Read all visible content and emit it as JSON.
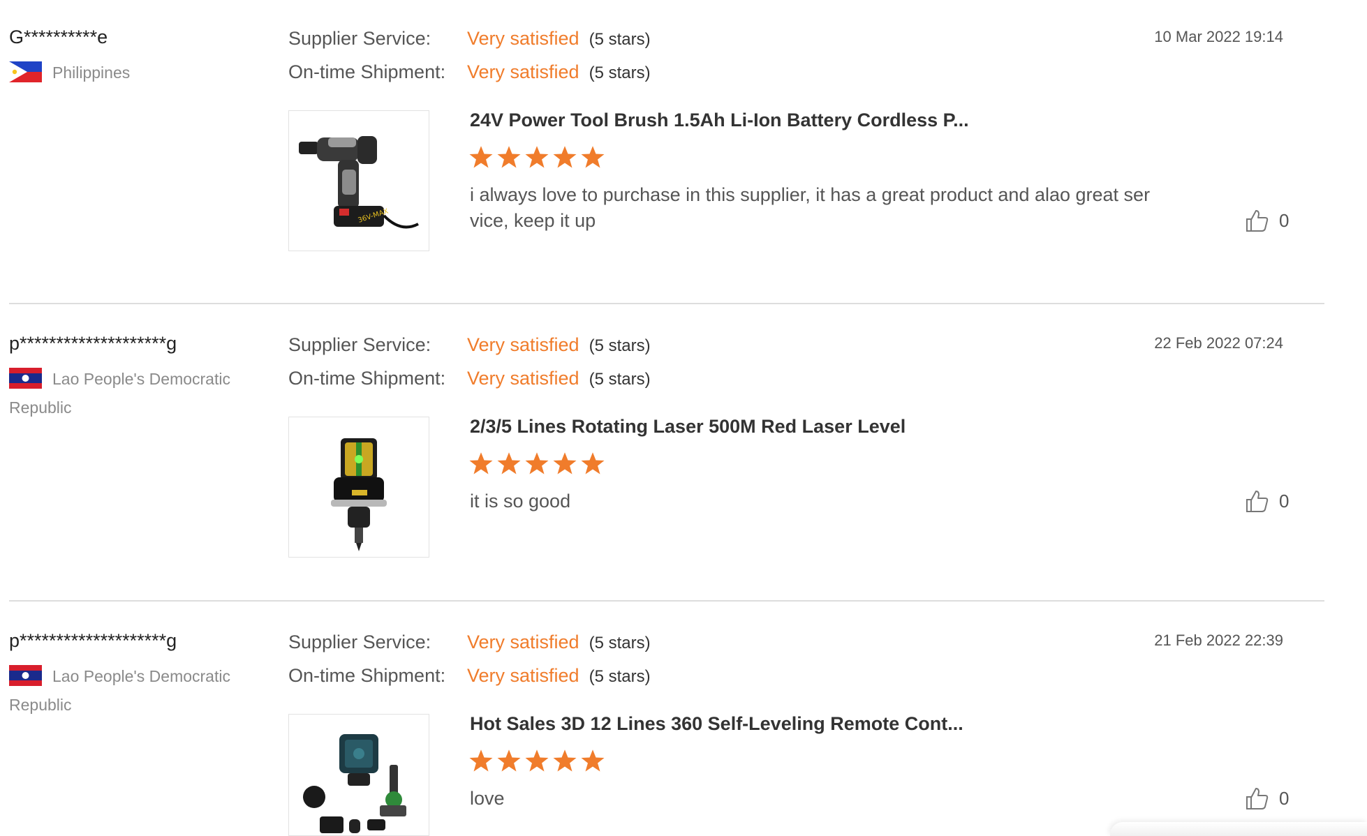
{
  "labels": {
    "supplier_service": "Supplier Service:",
    "ontime_shipment": "On-time Shipment:"
  },
  "colors": {
    "accent": "#f07c2b",
    "divider": "#dddddd"
  },
  "reviews": [
    {
      "buyer": "G**********e",
      "country": "Philippines",
      "flag_icon": "philippines-flag-icon",
      "supplier_service": {
        "value": "Very satisfied",
        "stars_text": "(5 stars)"
      },
      "ontime_shipment": {
        "value": "Very satisfied",
        "stars_text": "(5 stars)"
      },
      "date": "10 Mar 2022 19:14",
      "product_image": "cordless-drill-image",
      "product_title": "24V Power Tool Brush 1.5Ah Li-Ion Battery Cordless P...",
      "rating": 5,
      "comment": "i always love to purchase in this supplier, it has a great product and alao great ser vice, keep it up",
      "likes": "0"
    },
    {
      "buyer": "p********************g",
      "country": "Lao People's Democratic Republic",
      "flag_icon": "laos-flag-icon",
      "supplier_service": {
        "value": "Very satisfied",
        "stars_text": "(5 stars)"
      },
      "ontime_shipment": {
        "value": "Very satisfied",
        "stars_text": "(5 stars)"
      },
      "date": "22 Feb 2022 07:24",
      "product_image": "laser-level-image",
      "product_title": "2/3/5 Lines Rotating Laser 500M Red Laser Level",
      "rating": 5,
      "comment": "it is so good",
      "likes": "0"
    },
    {
      "buyer": "p********************g",
      "country": "Lao People's Democratic Republic",
      "flag_icon": "laos-flag-icon",
      "supplier_service": {
        "value": "Very satisfied",
        "stars_text": "(5 stars)"
      },
      "ontime_shipment": {
        "value": "Very satisfied",
        "stars_text": "(5 stars)"
      },
      "date": "21 Feb 2022 22:39",
      "product_image": "laser-level-kit-image",
      "product_title": "Hot Sales 3D 12 Lines 360 Self-Leveling Remote Cont...",
      "rating": 5,
      "comment": "love",
      "likes": "0"
    }
  ]
}
